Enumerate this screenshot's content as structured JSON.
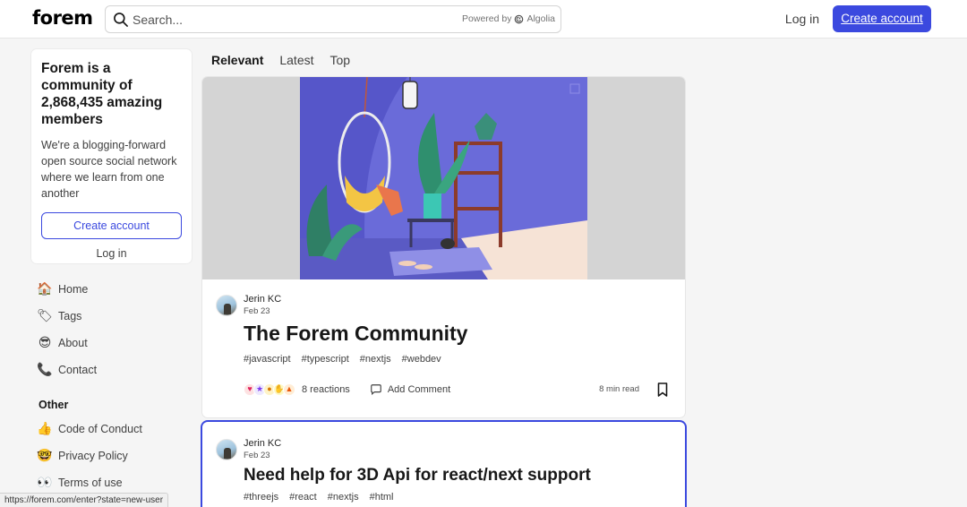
{
  "header": {
    "logo_text": "forem",
    "search_placeholder": "Search...",
    "powered_by": "Powered by",
    "powered_brand": "Algolia",
    "login_label": "Log in",
    "create_account_label": "Create account",
    "accent_color": "#3b49df"
  },
  "community": {
    "heading": "Forem is a community of 2,868,435 amazing members",
    "description": "We're a blogging-forward open source social network where we learn from one another",
    "create_account_label": "Create account",
    "login_label": "Log in"
  },
  "nav": {
    "items": [
      {
        "icon": "house-icon",
        "glyph": "🏠",
        "label": "Home"
      },
      {
        "icon": "tag-icon",
        "glyph": "🏷",
        "label": "Tags"
      },
      {
        "icon": "sunglasses-icon",
        "glyph": "😎",
        "label": "About"
      },
      {
        "icon": "contact-icon",
        "glyph": "📞",
        "label": "Contact"
      }
    ],
    "other_heading": "Other",
    "other_items": [
      {
        "icon": "thumbs-up-icon",
        "glyph": "👍",
        "label": "Code of Conduct"
      },
      {
        "icon": "nerd-face-icon",
        "glyph": "🤓",
        "label": "Privacy Policy"
      },
      {
        "icon": "eyes-icon",
        "glyph": "👀",
        "label": "Terms of use"
      }
    ]
  },
  "feed": {
    "tabs": [
      "Relevant",
      "Latest",
      "Top"
    ],
    "active_tab": "Relevant",
    "posts": [
      {
        "author": "Jerin KC",
        "date": "Feb 23",
        "title": "The Forem Community",
        "tags": [
          "#javascript",
          "#typescript",
          "#nextjs",
          "#webdev"
        ],
        "reactions": "8 reactions",
        "comment_label": "Add Comment",
        "read_time": "8 min read"
      },
      {
        "author": "Jerin KC",
        "date": "Feb 23",
        "title": "Need help for 3D Api for react/next support",
        "tags": [
          "#threejs",
          "#react",
          "#nextjs",
          "#html"
        ]
      }
    ]
  },
  "status_url": "https://forem.com/enter?state=new-user"
}
